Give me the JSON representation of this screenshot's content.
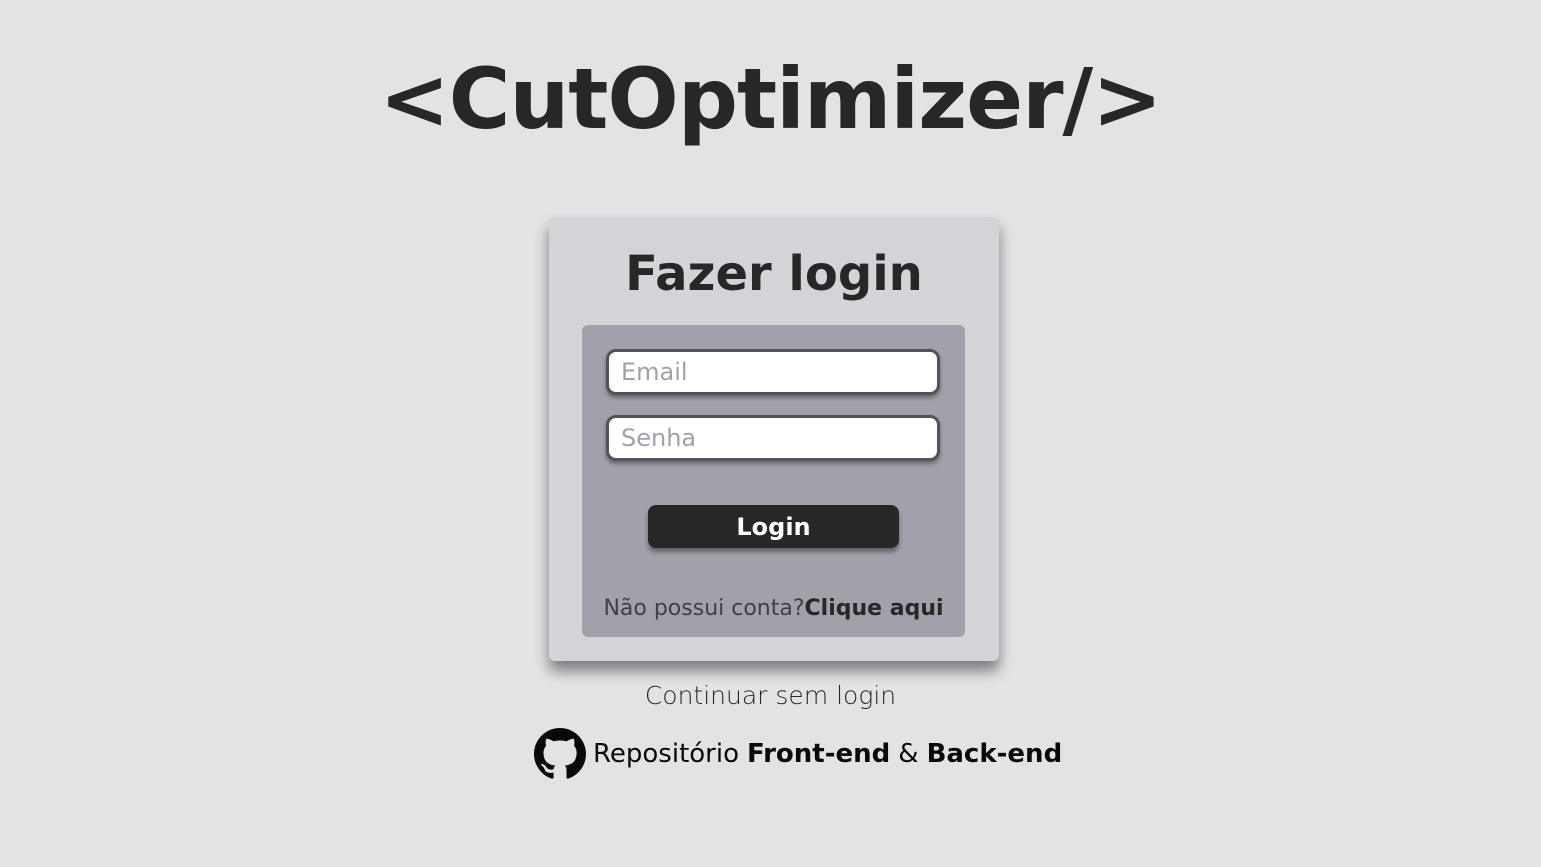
{
  "app": {
    "title": "<CutOptimizer/>"
  },
  "login_card": {
    "title": "Fazer login",
    "email_placeholder": "Email",
    "password_placeholder": "Senha",
    "login_button": "Login",
    "no_account_text": "Não possui conta?",
    "signup_link": "Clique aqui"
  },
  "guest": {
    "label": "Continuar sem login"
  },
  "repository": {
    "icon": "github-icon",
    "label": "Repositório",
    "frontend_link": "Front-end",
    "separator": "&",
    "backend_link": "Back-end"
  },
  "colors": {
    "background": "#e3e3e5",
    "card": "#d4d4d8",
    "panel": "#a1a1aa",
    "primary": "#27272a"
  }
}
